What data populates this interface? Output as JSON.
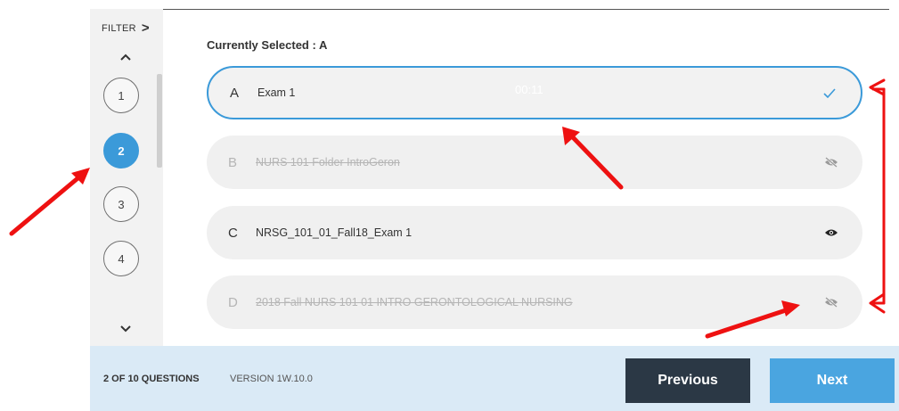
{
  "sidebar": {
    "filter_label": "FILTER",
    "filter_chevron": ">",
    "questions": [
      "1",
      "2",
      "3",
      "4"
    ],
    "active_question": "2",
    "icons": {
      "up": "chevron-up-icon",
      "down": "chevron-down-icon"
    }
  },
  "main": {
    "currently_selected": "Currently Selected : A",
    "timer": "00:11",
    "options": [
      {
        "letter": "A",
        "text": "Exam 1",
        "state": "selected",
        "icon": "check-icon"
      },
      {
        "letter": "B",
        "text": "NURS 101 Folder IntroGeron",
        "state": "hidden",
        "icon": "eye-off-icon"
      },
      {
        "letter": "C",
        "text": "NRSG_101_01_Fall18_Exam 1",
        "state": "visible",
        "icon": "eye-icon"
      },
      {
        "letter": "D",
        "text": "2018 Fall NURS 101 01 INTRO GERONTOLOGICAL NURSING",
        "state": "hidden",
        "icon": "eye-off-icon"
      }
    ]
  },
  "footer": {
    "question_count": "2 OF 10 QUESTIONS",
    "version": "VERSION 1W.10.0",
    "previous_label": "Previous",
    "next_label": "Next"
  },
  "colors": {
    "accent": "#3b9ad9",
    "previous_button": "#2b3845",
    "next_button": "#4aa5e0",
    "footer_bg": "#daeaf6",
    "annotation_red": "#ee1111"
  }
}
